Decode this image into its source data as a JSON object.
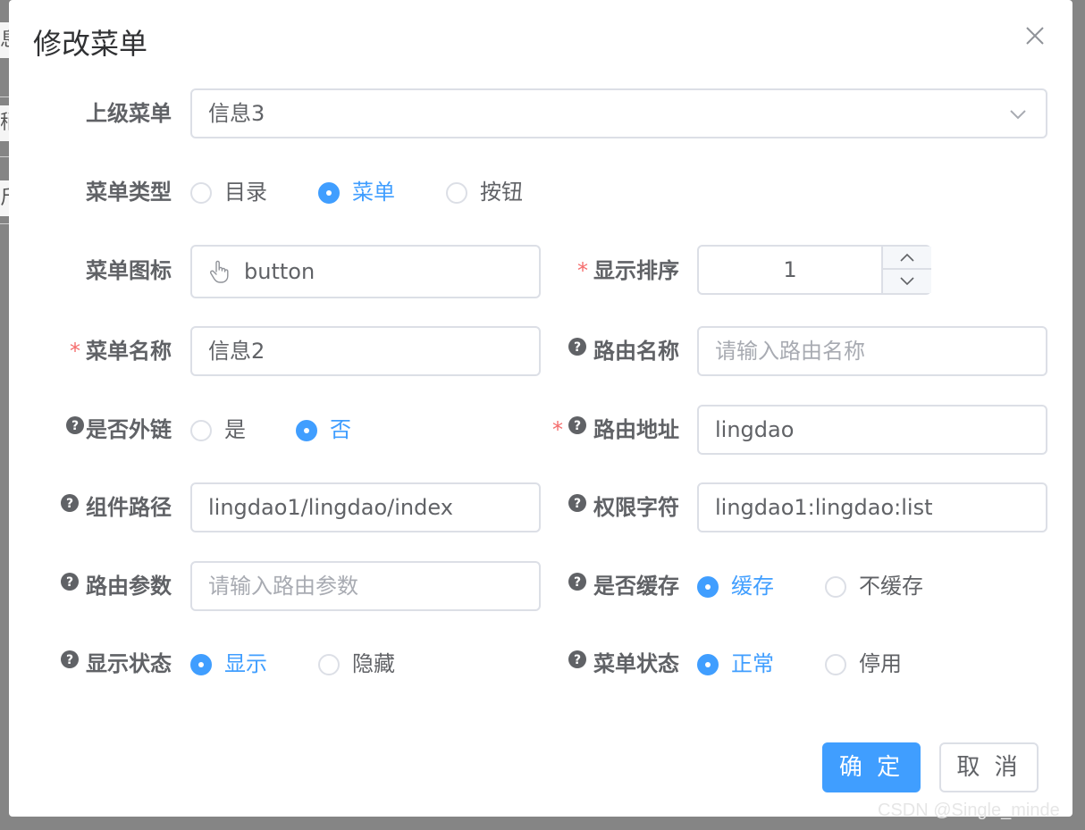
{
  "background": {
    "frag1": "息",
    "frag2": "稍",
    "frag3": "斤"
  },
  "dialog": {
    "title": "修改菜单",
    "close_icon": "close-icon"
  },
  "form": {
    "parent_menu": {
      "label": "上级菜单",
      "value": "信息3"
    },
    "menu_type": {
      "label": "菜单类型",
      "options": [
        "目录",
        "菜单",
        "按钮"
      ],
      "selected": "菜单"
    },
    "menu_icon": {
      "label": "菜单图标",
      "value": "button",
      "icon": "hand-pointer-icon"
    },
    "display_order": {
      "label": "显示排序",
      "required_mark": "*",
      "value": "1"
    },
    "menu_name": {
      "label": "菜单名称",
      "required_mark": "*",
      "value": "信息2"
    },
    "route_name": {
      "label": "路由名称",
      "placeholder": "请输入路由名称"
    },
    "is_external": {
      "label": "是否外链",
      "options": [
        "是",
        "否"
      ],
      "selected": "否"
    },
    "route_path": {
      "label": "路由地址",
      "required_mark": "*",
      "value": "lingdao"
    },
    "component_path": {
      "label": "组件路径",
      "value": "lingdao1/lingdao/index"
    },
    "permission": {
      "label": "权限字符",
      "value": "lingdao1:lingdao:list"
    },
    "route_params": {
      "label": "路由参数",
      "placeholder": "请输入路由参数"
    },
    "is_cache": {
      "label": "是否缓存",
      "options": [
        "缓存",
        "不缓存"
      ],
      "selected": "缓存"
    },
    "visible": {
      "label": "显示状态",
      "options": [
        "显示",
        "隐藏"
      ],
      "selected": "显示"
    },
    "status": {
      "label": "菜单状态",
      "options": [
        "正常",
        "停用"
      ],
      "selected": "正常"
    }
  },
  "footer": {
    "confirm": "确 定",
    "cancel": "取 消"
  },
  "watermark": "CSDN @Single_minde",
  "colors": {
    "primary": "#409eff",
    "required": "#f56c6c",
    "text": "#606266",
    "border": "#dcdfe6",
    "overlay": "#858585"
  }
}
